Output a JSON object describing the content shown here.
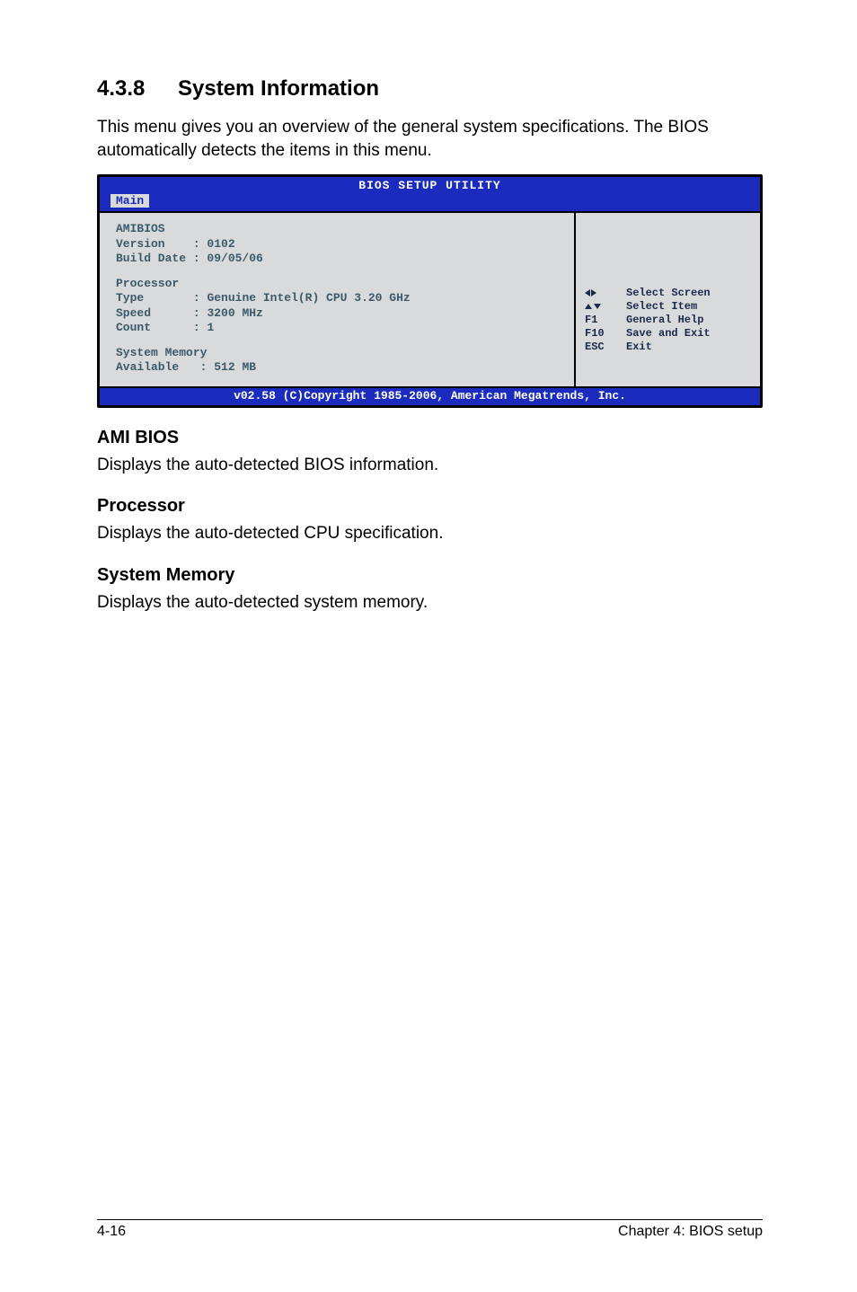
{
  "heading": {
    "num": "4.3.8",
    "title": "System Information"
  },
  "intro": "This menu gives you an overview of the general system specifications. The BIOS automatically detects the items in this menu.",
  "bios": {
    "title": "BIOS SETUP UTILITY",
    "tab": "Main",
    "amibios": {
      "label": "AMIBIOS",
      "version_label": "Version",
      "version_value": "0102",
      "build_label": "Build Date",
      "build_value": "09/05/06"
    },
    "processor": {
      "label": "Processor",
      "type_label": "Type",
      "type_value": "Genuine Intel(R) CPU 3.20 GHz",
      "speed_label": "Speed",
      "speed_value": "3200 MHz",
      "count_label": "Count",
      "count_value": "1"
    },
    "memory": {
      "label": "System Memory",
      "avail_label": "Available",
      "avail_value": "512 MB"
    },
    "help": {
      "select_screen": "Select Screen",
      "select_item": "Select Item",
      "f1_key": "F1",
      "f1_label": "General Help",
      "f10_key": "F10",
      "f10_label": "Save and Exit",
      "esc_key": "ESC",
      "esc_label": "Exit"
    },
    "footer": "v02.58 (C)Copyright 1985-2006, American Megatrends, Inc."
  },
  "sections": {
    "amibios_h": "AMI BIOS",
    "amibios_t": "Displays the auto-detected BIOS information.",
    "proc_h": "Processor",
    "proc_t": "Displays the auto-detected CPU specification.",
    "mem_h": "System Memory",
    "mem_t": "Displays the auto-detected system memory."
  },
  "footer": {
    "left": "4-16",
    "right": "Chapter 4: BIOS setup"
  }
}
